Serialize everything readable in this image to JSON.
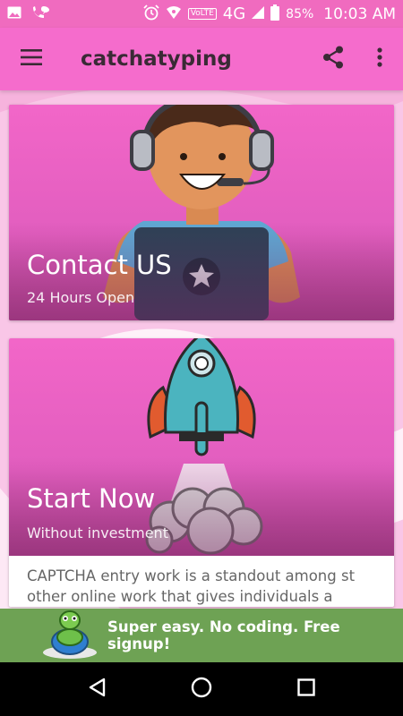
{
  "status_bar": {
    "battery": "85%",
    "time": "10:03 AM",
    "network": "4G",
    "volte": "VoLTE",
    "icons": [
      "image-icon",
      "call-icon",
      "alarm-icon",
      "wifi-icon",
      "signal-icon",
      "battery-icon"
    ]
  },
  "app_bar": {
    "title": "catchatyping",
    "icons": [
      "menu-icon",
      "share-icon",
      "more-vert-icon"
    ]
  },
  "cards": [
    {
      "title": "Contact US",
      "subtitle": "24 Hours Open"
    },
    {
      "title": "Start Now",
      "subtitle": "Without investment",
      "description": "CAPTCHA entry work is a standout among st other online work that gives individuals a simple earning"
    }
  ],
  "ad_banner": {
    "text": "Super easy. No coding. Free signup!"
  },
  "nav_bar": {
    "icons": [
      "back-icon",
      "home-icon",
      "recents-icon"
    ]
  },
  "colors": {
    "primary": "#f56ccc",
    "status_bar": "#f06bbf",
    "ad_banner": "#6ea254"
  }
}
